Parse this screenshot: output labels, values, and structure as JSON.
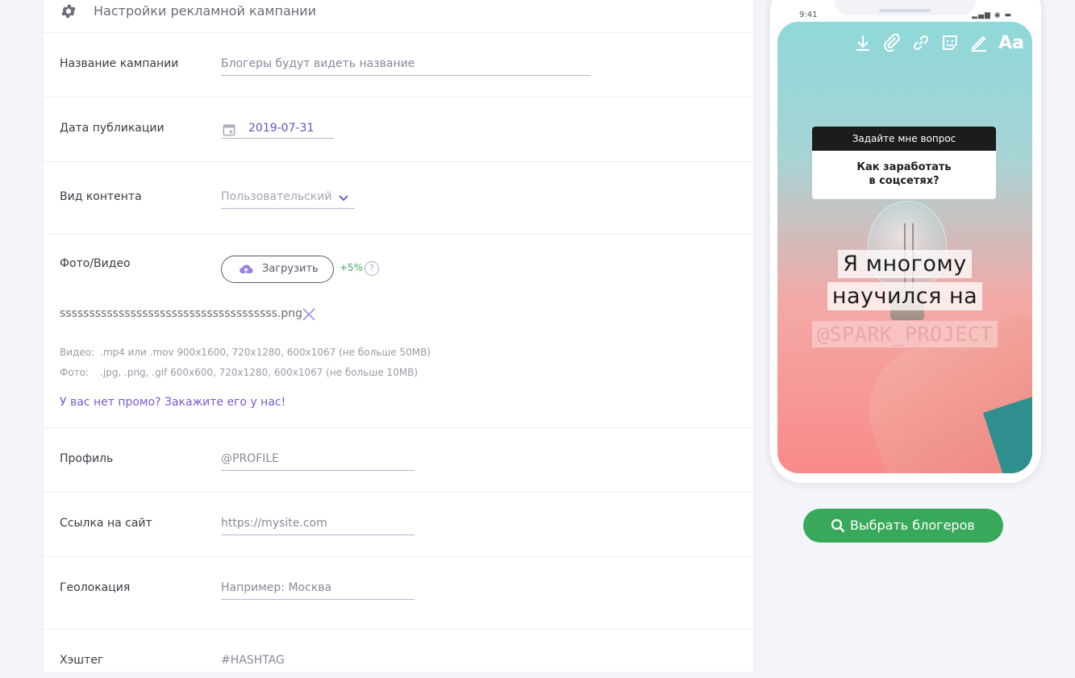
{
  "header": {
    "title": "Настройки рекламной кампании",
    "icon": "gear-icon"
  },
  "form": {
    "campaign_name": {
      "label": "Название кампании",
      "placeholder": "Блогеры будут видеть название"
    },
    "publish_date": {
      "label": "Дата публикации",
      "value": "2019-07-31",
      "icon": "calendar-icon"
    },
    "content_type": {
      "label": "Вид контента",
      "value": "Пользовательский",
      "icon": "chevron-down-icon"
    },
    "media": {
      "label": "Фото/Видео",
      "upload_label": "Загрузить",
      "bonus": "+5%",
      "help": "?",
      "filename": "sssssssssssssssssssssssssssssssssssss.png",
      "video_key": "Видео:",
      "video_hint": ".mp4 или .mov 900x1600, 720x1280, 600x1067 (не больше 50MB)",
      "photo_key": "Фото:",
      "photo_hint": ".jpg, .png, .gif 600x600, 720x1280, 600x1067 (не больше 10MB)",
      "promo_link": "У вас нет промо? Закажите его у нас!"
    },
    "profile": {
      "label": "Профиль",
      "placeholder": "@PROFILE"
    },
    "site": {
      "label": "Ссылка на сайт",
      "placeholder": "https://mysite.com"
    },
    "geo": {
      "label": "Геолокация",
      "placeholder": "Например: Москва"
    },
    "hashtag": {
      "label": "Хэштег",
      "placeholder": "#HASHTAG"
    }
  },
  "preview": {
    "status_time": "9:41",
    "tools": [
      "download-icon",
      "paperclip-icon",
      "link-icon",
      "sticker-icon",
      "pen-icon"
    ],
    "text_tool": "Aa",
    "question_header": "Задайте мне вопрос",
    "question_line1": "Как заработать",
    "question_line2": "в соцсетях?",
    "caption_line1": "Я многому",
    "caption_line2": "научился на",
    "caption_tag": "@SPARK_PROJECT"
  },
  "actions": {
    "find_bloggers": "Выбрать блогеров"
  },
  "colors": {
    "accent": "#6a4fc7",
    "green": "#38a85a",
    "border": "#eceef3"
  }
}
